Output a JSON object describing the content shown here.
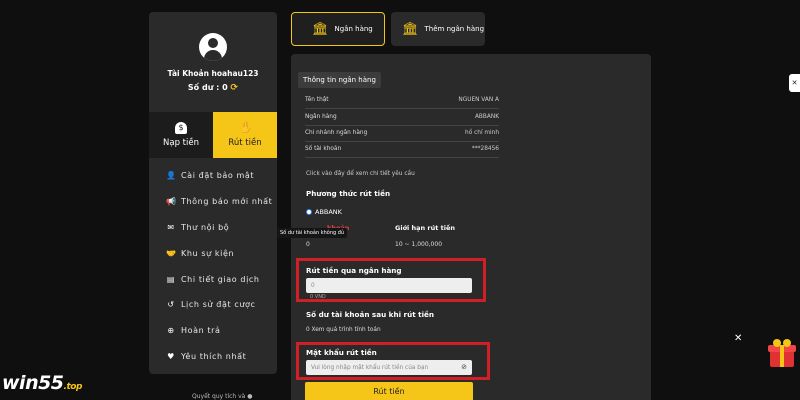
{
  "sidebar": {
    "account_label": "Tài Khoản hoahau123",
    "balance_label": "Số dư : 0",
    "tabs": {
      "deposit": "Nạp tiền",
      "withdraw": "Rút tiền"
    },
    "menu": [
      {
        "label": "Cài đặt bảo mật",
        "icon": "user-gear-icon"
      },
      {
        "label": "Thông báo mới nhất",
        "icon": "megaphone-icon"
      },
      {
        "label": "Thư nội bộ",
        "icon": "mail-icon"
      },
      {
        "label": "Khu sự kiện",
        "icon": "handshake-icon"
      },
      {
        "label": "Chi tiết giao dịch",
        "icon": "document-icon"
      },
      {
        "label": "Lịch sử đặt cược",
        "icon": "history-icon"
      },
      {
        "label": "Hoàn trả",
        "icon": "refund-icon"
      },
      {
        "label": "Yêu thích nhất",
        "icon": "heart-icon"
      }
    ]
  },
  "logo": {
    "main": "win55",
    "suffix": ".top"
  },
  "footer_text": "Quyết quy tích và ●",
  "top_tabs": {
    "bank": "Ngân hàng",
    "add_bank": "Thêm ngân hàng"
  },
  "panel": {
    "title": "Thông tin ngân hàng",
    "rows": [
      {
        "label": "Tên thật",
        "value": "NGUEN VAN A"
      },
      {
        "label": "Ngân hàng",
        "value": "ABBANK"
      },
      {
        "label": "Chi nhánh ngân hàng",
        "value": "hồ chí minh"
      },
      {
        "label": "Số tài khoản",
        "value": "***28456"
      }
    ],
    "hint": "Click vào đây để xem chi tiết yêu cầu",
    "method_heading": "Phương thức rút tiền",
    "method_option": "ABBANK",
    "limit_left_label": "khoản",
    "limit_right_label": "Giới hạn rút tiền",
    "limit_left_value": "0",
    "limit_right_value": "10 ~ 1,000,000",
    "tooltip": "Số dư tài khoản không đủ",
    "bank_withdraw_label": "Rút tiền qua ngân hàng",
    "amount_value": "0",
    "amount_sub": "0 VND",
    "after_label": "Số dư tài khoản sau khi rút tiền",
    "after_value": "0   Xem quá trình tính toán",
    "password_label": "Mật khẩu rút tiền",
    "password_placeholder": "Vui lòng nhập mật khẩu rút tiền của bạn",
    "submit": "Rút tiền"
  },
  "colors": {
    "accent": "#f5c518",
    "highlight": "#d01f26",
    "panel": "#2a2a2a"
  }
}
